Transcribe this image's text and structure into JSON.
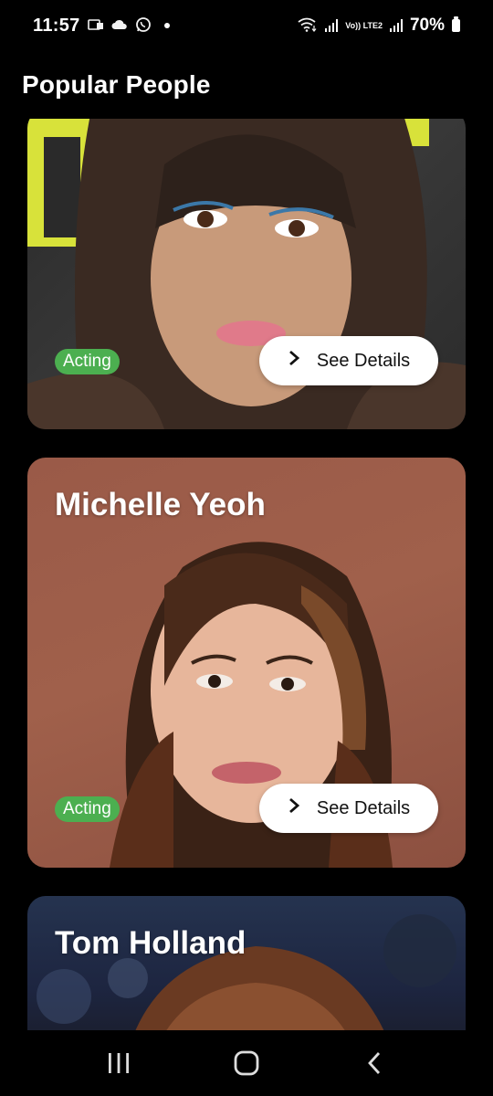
{
  "status_bar": {
    "time": "11:57",
    "battery": "70%",
    "lte_label": "Vo)) LTE2"
  },
  "header": {
    "title": "Popular People"
  },
  "people": [
    {
      "name": "",
      "department": "Acting",
      "details_label": "See Details"
    },
    {
      "name": "Michelle Yeoh",
      "department": "Acting",
      "details_label": "See Details"
    },
    {
      "name": "Tom Holland"
    }
  ],
  "icons": {
    "details": "chevron-right-icon",
    "nav": [
      "recent-apps-icon",
      "home-icon",
      "back-icon"
    ]
  },
  "colors": {
    "badge": "#4caf50",
    "background": "#000000",
    "button": "#ffffff"
  }
}
